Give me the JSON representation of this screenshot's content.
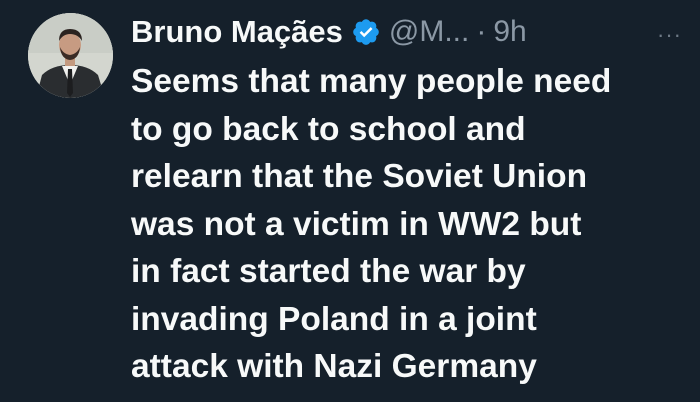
{
  "tweet": {
    "author_name": "Bruno Maçães",
    "handle": "@M...",
    "separator": "·",
    "time": "9h",
    "more_label": "···",
    "verified_icon": "verified-badge-icon",
    "verified_color": "#1d9bf0",
    "body_lines": [
      "Seems that many people need",
      "to go back to school and",
      "relearn that the Soviet Union",
      "was not a victim in WW2 but",
      "in fact started the war by",
      "invading Poland in a joint",
      "attack with Nazi Germany"
    ]
  },
  "theme": {
    "background": "#15202b",
    "text": "#f7f9f9",
    "muted": "#8b98a5"
  }
}
